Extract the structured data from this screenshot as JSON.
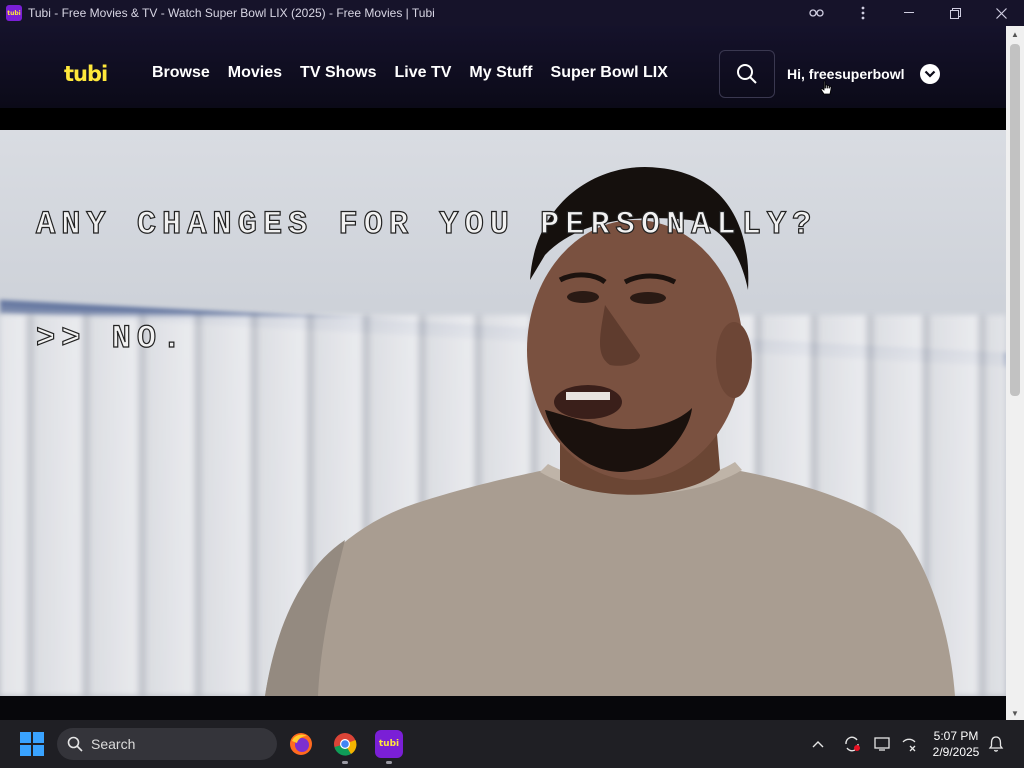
{
  "window": {
    "title": "Tubi - Free Movies & TV - Watch Super Bowl LIX (2025) - Free Movies | Tubi",
    "app_icon_text": "tubi"
  },
  "header": {
    "logo": "tubi",
    "nav": [
      "Browse",
      "Movies",
      "TV Shows",
      "Live TV",
      "My Stuff",
      "Super Bowl LIX"
    ],
    "user_greeting": "Hi, freesuperbowl"
  },
  "video": {
    "caption_line1": "ANY CHANGES FOR YOU PERSONALLY?",
    "caption_line2": ">> NO."
  },
  "taskbar": {
    "search_label": "Search",
    "time": "5:07 PM",
    "date": "2/9/2025"
  },
  "colors": {
    "brand_yellow": "#ffe83b",
    "brand_purple": "#7a1fd6",
    "header_bg": "#15122b"
  }
}
